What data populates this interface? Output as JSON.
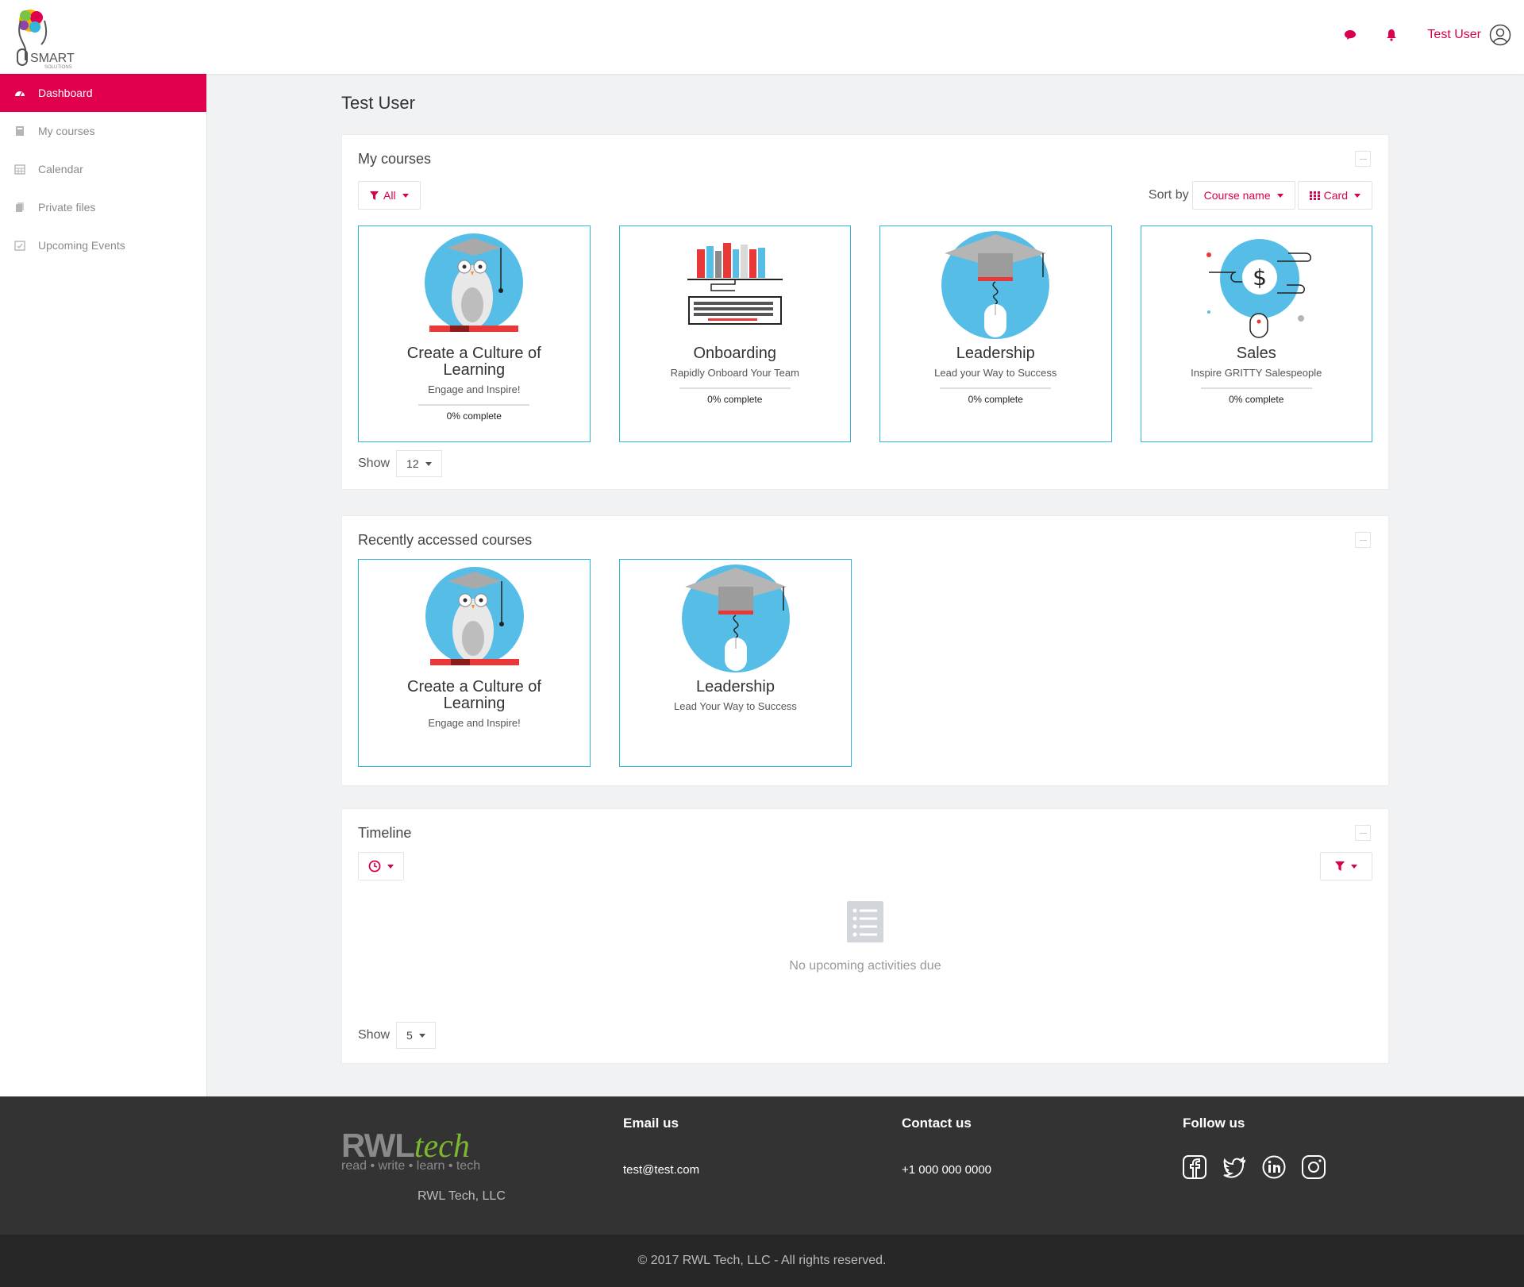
{
  "header": {
    "logo_text": "SMART",
    "logo_subtext": "SOLUTIONS",
    "user_name": "Test User",
    "accent_color": "#d8004f"
  },
  "sidebar": {
    "items": [
      {
        "label": "Dashboard",
        "icon": "dashboard-icon",
        "active": true
      },
      {
        "label": "My courses",
        "icon": "book-icon",
        "active": false
      },
      {
        "label": "Calendar",
        "icon": "calendar-icon",
        "active": false
      },
      {
        "label": "Private files",
        "icon": "files-icon",
        "active": false
      },
      {
        "label": "Upcoming Events",
        "icon": "calendar-check-icon",
        "active": false
      }
    ]
  },
  "main": {
    "page_title": "Test User",
    "my_courses": {
      "title": "My courses",
      "filter_label": "All",
      "sort_by_label": "Sort by",
      "sort_value": "Course name",
      "view_value": "Card",
      "show_label": "Show",
      "show_value": "12",
      "courses": [
        {
          "name": "Create a Culture of Learning",
          "subtitle": "Engage and Inspire!",
          "progress": "0% complete",
          "illustration": "owl-icon"
        },
        {
          "name": "Onboarding",
          "subtitle": "Rapidly Onboard Your Team",
          "progress": "0% complete",
          "illustration": "books-keyboard-icon"
        },
        {
          "name": "Leadership",
          "subtitle": "Lead your Way to Success",
          "progress": "0% complete",
          "illustration": "graduation-mouse-icon"
        },
        {
          "name": "Sales",
          "subtitle": "Inspire GRITTY Salespeople",
          "progress": "0% complete",
          "illustration": "dollar-mouse-icon"
        }
      ]
    },
    "recent": {
      "title": "Recently accessed courses",
      "courses": [
        {
          "name": "Create a Culture of Learning",
          "subtitle": "Engage and Inspire!"
        },
        {
          "name": "Leadership",
          "subtitle": "Lead Your Way to Success"
        }
      ]
    },
    "timeline": {
      "title": "Timeline",
      "empty_message": "No upcoming activities due",
      "show_label": "Show",
      "show_value": "5"
    }
  },
  "footer": {
    "brand_main": "RWL",
    "brand_accent": "tech",
    "brand_tagline": "read • write • learn • tech",
    "company": "RWL Tech, LLC",
    "email_heading": "Email us",
    "email": "test@test.com",
    "contact_heading": "Contact us",
    "phone": "+1 000 000 0000",
    "follow_heading": "Follow us",
    "social": [
      "facebook-icon",
      "twitter-icon",
      "linkedin-icon",
      "instagram-icon"
    ],
    "copyright": "© 2017 RWL Tech, LLC - All rights reserved."
  }
}
